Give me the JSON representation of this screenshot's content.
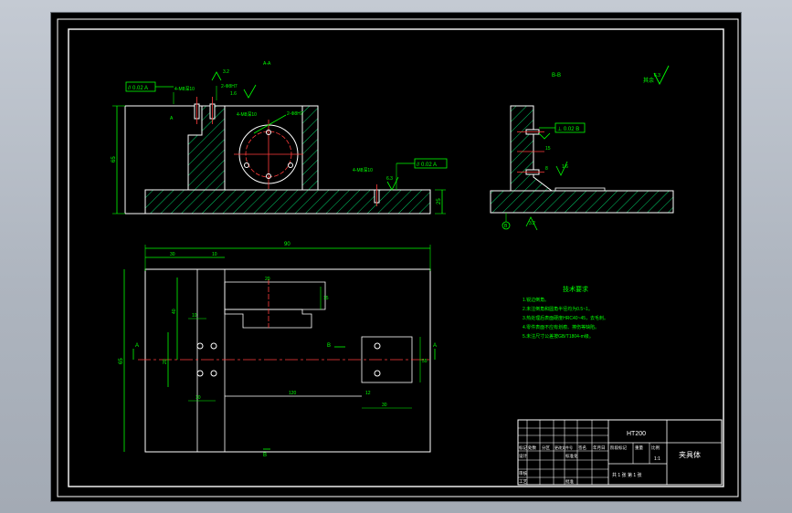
{
  "drawing": {
    "views": {
      "front_section": "A-A",
      "side_section": "B-B"
    },
    "dimensions": {
      "overall_length": "90",
      "overall_height": "65",
      "left_offset_1": "30",
      "left_offset_2": "10",
      "slot_width": "20",
      "slot_length": "120",
      "hole_spacing_1": "40",
      "hole_spacing_2": "20",
      "hole_spacing_3": "10",
      "right_block_dim": "30",
      "right_block_width": "12",
      "right_block_height": "55",
      "left_vertical": "65",
      "left_vertical_2": "25",
      "right_slot_1": "15",
      "right_slot_2": "8"
    },
    "callouts": {
      "parallel_tol_1": "// 0.02 A",
      "parallel_tol_2": "// 0.02 A",
      "perp_tol": "⊥ 0.02 B",
      "hole_spec_1": "4-M8深10",
      "hole_spec_2": "2-Φ8H7",
      "hole_spec_3": "4-M8深10",
      "roughness_1": "3.2",
      "roughness_2": "1.6",
      "roughness_3": "6.3",
      "datum_a": "A",
      "datum_b": "B",
      "section_mark": "A"
    },
    "tech_requirements": {
      "title": "技术要求",
      "items": [
        "1.锐边倒角。",
        "2.未注倒角和圆角半径均为0.5~1。",
        "3.热处理后表面硬度HRC40~45，去毛刺。",
        "4.零件表面不应有划痕、擦伤等缺陷。",
        "5.未注尺寸公差按GB/T1804-m级。",
        "6.去除毛刺。"
      ]
    },
    "roughness_note": "其余"
  },
  "title_block": {
    "drawing_number": "HT200",
    "part_name": "夹具体",
    "scale": "1:1",
    "sheet": "共 1 张 第 1 张",
    "labels": [
      "标记",
      "处数",
      "分区",
      "更改文件号",
      "签名",
      "年月日"
    ],
    "row2": [
      "设计",
      "标准化",
      "阶段标记",
      "重量",
      "比例"
    ],
    "row3": [
      "审核",
      "工艺",
      "批准"
    ]
  }
}
